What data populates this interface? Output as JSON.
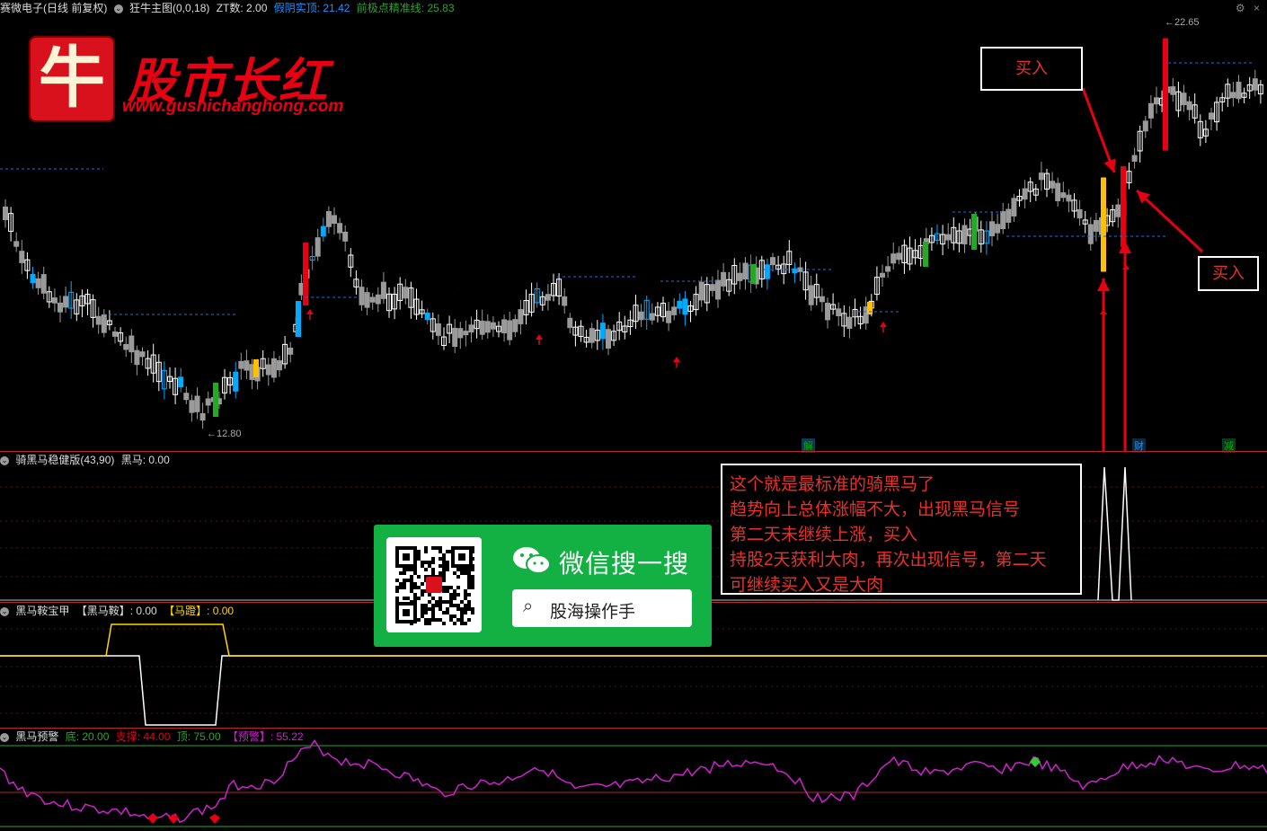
{
  "header": {
    "stock_name": "赛微电子(日线 前复权)",
    "main_chart_name": "狂牛主图(0,0,18)",
    "zt_count": "ZT数: 2.00",
    "fake_yin": "假阴实顶: 21.42",
    "pivot_line": "前极点精准线: 25.83"
  },
  "main_chart": {
    "price_high": "22.65",
    "price_low": "12.80",
    "event_markers": [
      "解",
      "财",
      "减"
    ]
  },
  "panels": {
    "panel1_title": "骑黑马稳健版(43,90)",
    "panel1_value": "黑马: 0.00",
    "panel2_title": "黑马鞍宝甲",
    "panel2_v1": "【黑马鞍】: 0.00",
    "panel2_v2": "【马蹬】: 0.00",
    "panel3_title": "黑马预警",
    "panel3_low": "底: 20.00",
    "panel3_support": "支撑: 44.00",
    "panel3_top": "顶: 75.00",
    "panel3_warn": "【预警】: 55.22"
  },
  "logo": {
    "char": "牛",
    "brand": "股市长红",
    "url": "www.gushichanghong.com"
  },
  "annotations": {
    "buy1": "买入",
    "buy2": "买入",
    "note_lines": [
      "这个就是最标准的骑黑马了",
      "趋势向上总体涨幅不大，出现黑马信号",
      "第二天未继续上涨，买入",
      "持股2天获利大肉，再次出现信号，第二天",
      "可继续买入又是大肉"
    ]
  },
  "wechat": {
    "title": "微信搜一搜",
    "search_text": "股海操作手"
  },
  "colors": {
    "up": "#e60012",
    "down": "#9a9a9a",
    "accent_blue": "#00aaff",
    "signal_yellow": "#ffc000",
    "signal_green": "#22aa22",
    "magenta": "#d020d0",
    "wechat_green": "#13b044"
  }
}
